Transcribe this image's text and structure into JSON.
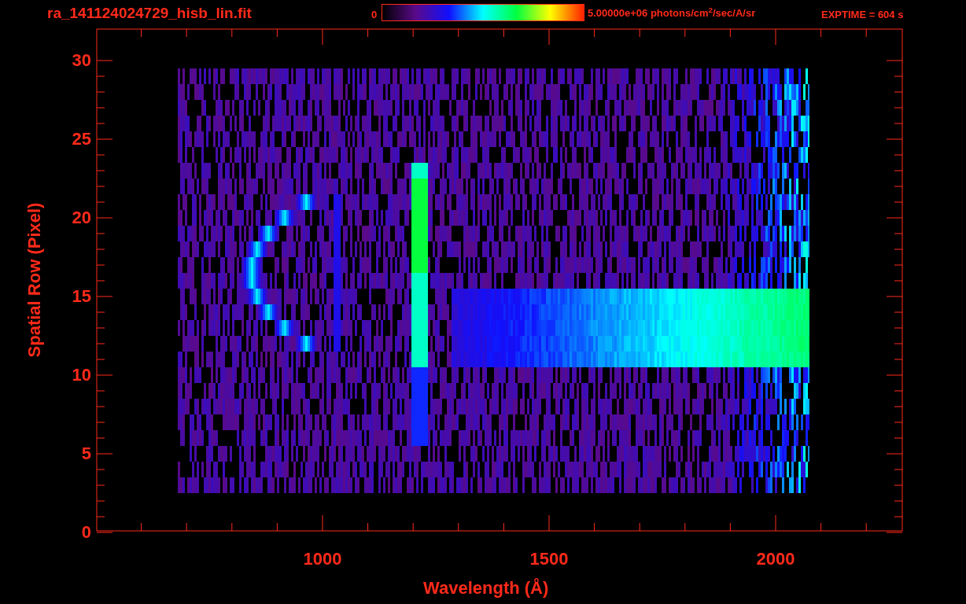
{
  "title": "ra_141124024729_hisb_lin.fit",
  "colorbar": {
    "min_label": "0",
    "max_label": "5.00000e+06 photons/cm$^{2}$/sec/A/sr"
  },
  "exptime": "EXPTIME = 604 s",
  "x_axis": {
    "title": "Wavelength (Å)",
    "ticks": [
      "1000",
      "1500",
      "2000"
    ]
  },
  "y_axis": {
    "title": "Spatial Row (Pixel)",
    "ticks": [
      "30",
      "25",
      "20",
      "15",
      "10",
      "5",
      "0"
    ]
  }
}
